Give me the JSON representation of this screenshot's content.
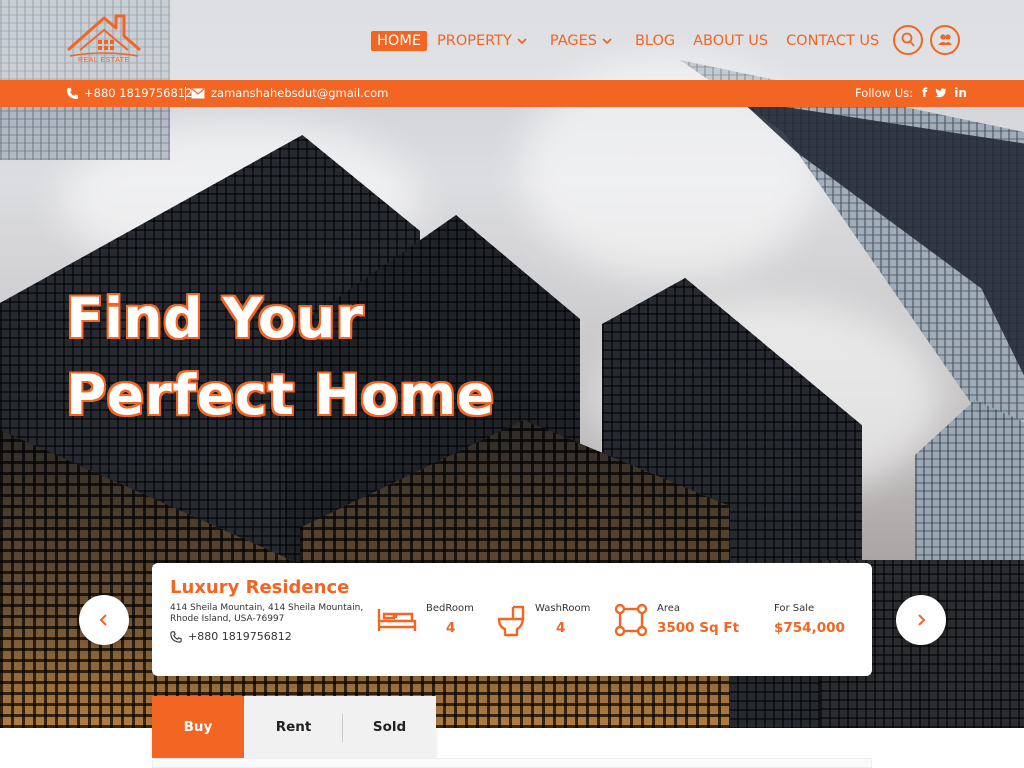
{
  "brand": {
    "logo_text": "REAL ESTATE",
    "accent_color": "#f26522"
  },
  "nav": {
    "items": [
      {
        "label": "HOME",
        "active": true
      },
      {
        "label": "PROPERTY",
        "dropdown": true
      },
      {
        "label": "PAGES",
        "dropdown": true
      },
      {
        "label": "BLOG"
      },
      {
        "label": "ABOUT US"
      },
      {
        "label": "CONTACT US"
      }
    ],
    "icons": [
      "user-icon",
      "users-icon"
    ]
  },
  "infobar": {
    "phone": "+880 1819756812",
    "email": "zamanshahebsdut@gmail.com",
    "follow_label": "Follow Us:",
    "social_icons": [
      "facebook-icon",
      "twitter-icon",
      "linkedin-icon"
    ]
  },
  "hero": {
    "headline_line1": "Find Your",
    "headline_line2": "Perfect Home"
  },
  "property": {
    "title": "Luxury Residence",
    "address": "414 Sheila Mountain, 414 Sheila Mountain, Rhode Island, USA-76997",
    "phone": "+880 1819756812",
    "features": {
      "bedroom_label": "BedRoom",
      "bedroom_value": "4",
      "washroom_label": "WashRoom",
      "washroom_value": "4",
      "area_label": "Area",
      "area_value": "3500 Sq Ft",
      "sale_label": "For Sale",
      "sale_value": "$754,000"
    }
  },
  "tabs": {
    "buy": "Buy",
    "rent": "Rent",
    "sold": "Sold",
    "active": "Buy"
  }
}
